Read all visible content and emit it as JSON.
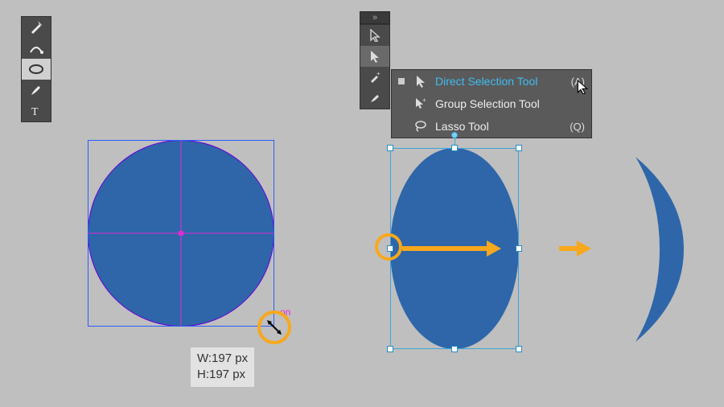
{
  "colors": {
    "shape_fill": "#2e66a9",
    "highlight": "#f7a81c",
    "selection": "#2a5cff",
    "magenta": "#e22ad6"
  },
  "left_toolbar": {
    "tools": [
      "pen",
      "curvature-pen",
      "ellipse",
      "paintbrush",
      "type"
    ],
    "selected": "ellipse"
  },
  "size_readout": {
    "w_label": "W:197 px",
    "h_label": "H:197 px"
  },
  "drag_badge": "on",
  "right_toolbar": {
    "header_glyph": "»",
    "tools": [
      "selection",
      "direct-selection",
      "eyedropper-plus",
      "paintbrush"
    ]
  },
  "flyout": {
    "items": [
      {
        "label": "Direct Selection Tool",
        "shortcut": "(A)",
        "active": true,
        "icon": "direct-selection"
      },
      {
        "label": "Group Selection Tool",
        "shortcut": "",
        "active": false,
        "icon": "group-selection"
      },
      {
        "label": "Lasso Tool",
        "shortcut": "(Q)",
        "active": false,
        "icon": "lasso"
      }
    ]
  }
}
